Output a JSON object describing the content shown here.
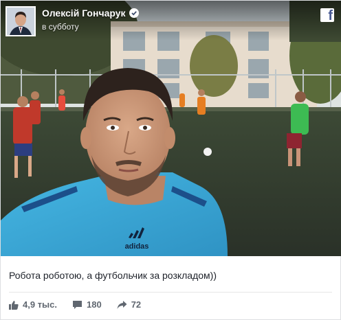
{
  "post": {
    "author_name": "Олексій Гончарук",
    "time": "в субботу",
    "caption": "Робота роботою, а футбольчик за розкладом))"
  },
  "stats": {
    "likes": "4,9 тыс.",
    "comments": "180",
    "shares": "72"
  },
  "photo": {
    "jersey_brand": "adidas"
  },
  "icons": {
    "verified": "verified-badge-icon",
    "facebook": "facebook-logo-icon",
    "like": "thumbs-up-icon",
    "comment": "comment-bubble-icon",
    "share": "share-arrow-icon"
  },
  "colors": {
    "caption_text": "#1d2129",
    "stat_text": "#606770",
    "facebook_blue": "#475993",
    "jersey": "#3aa9d8"
  }
}
